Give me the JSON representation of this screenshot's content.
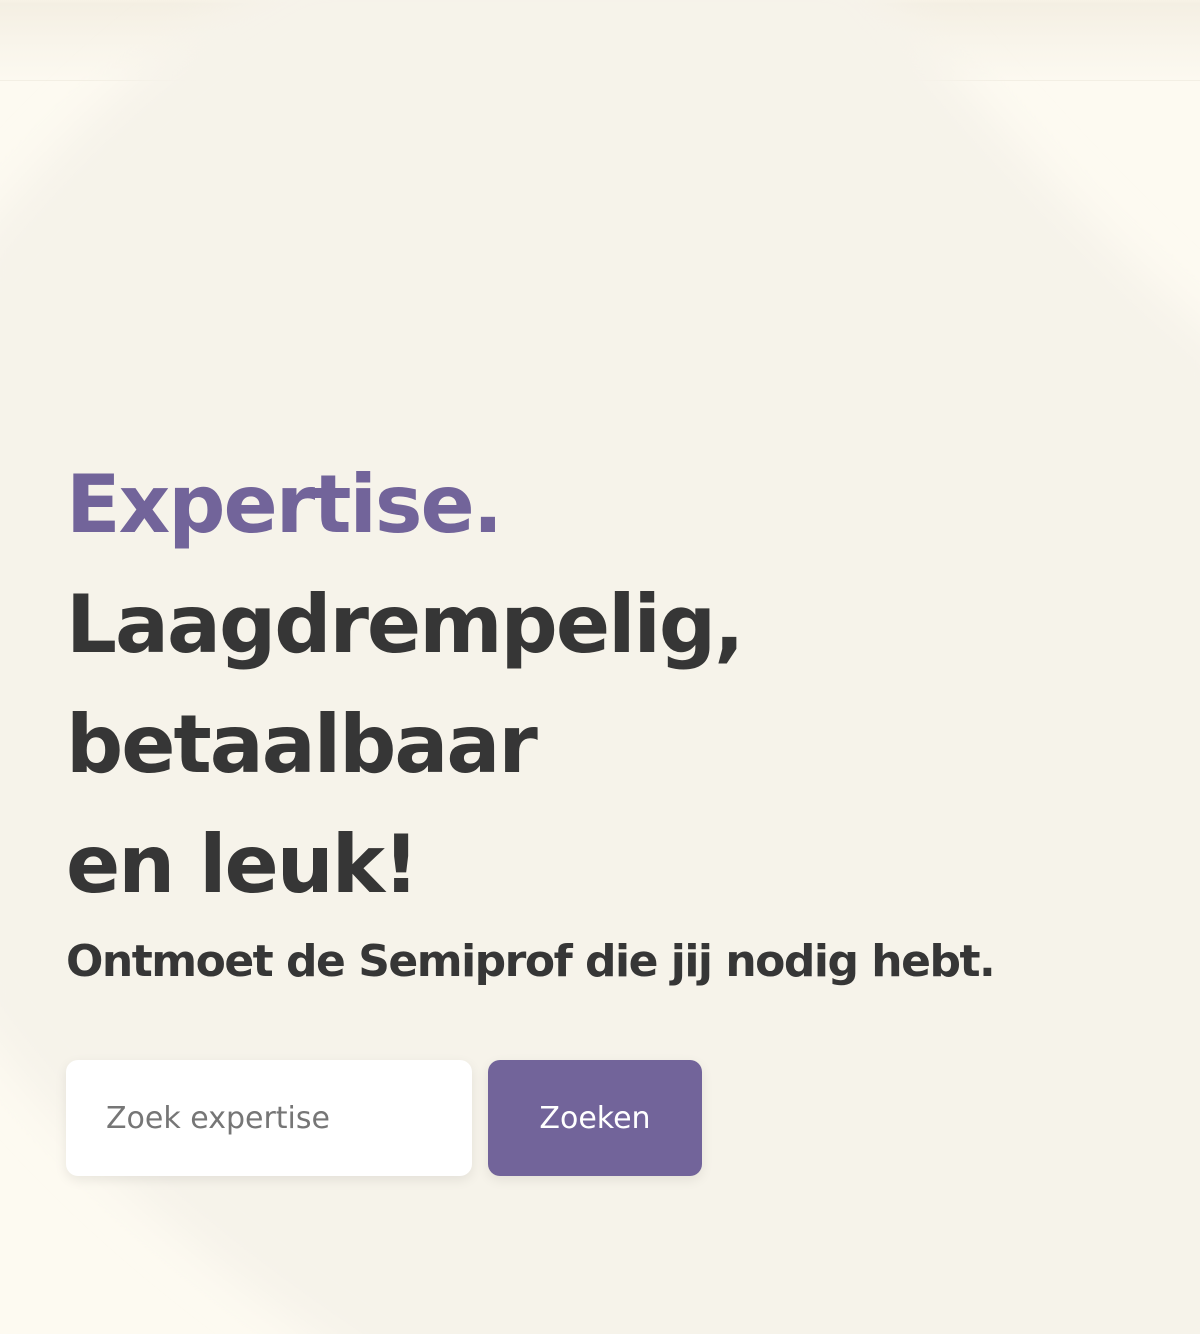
{
  "colors": {
    "accent": "#72649a",
    "text": "#363636",
    "background": "#fdfaf1",
    "button_text": "#ffffff"
  },
  "hero": {
    "accent": "Expertise.",
    "lines": [
      "Laagdrempelig,",
      "betaalbaar",
      "en leuk!"
    ],
    "subheading": "Ontmoet de Semiprof die jij nodig hebt."
  },
  "search": {
    "placeholder": "Zoek expertise",
    "button_label": "Zoeken"
  }
}
